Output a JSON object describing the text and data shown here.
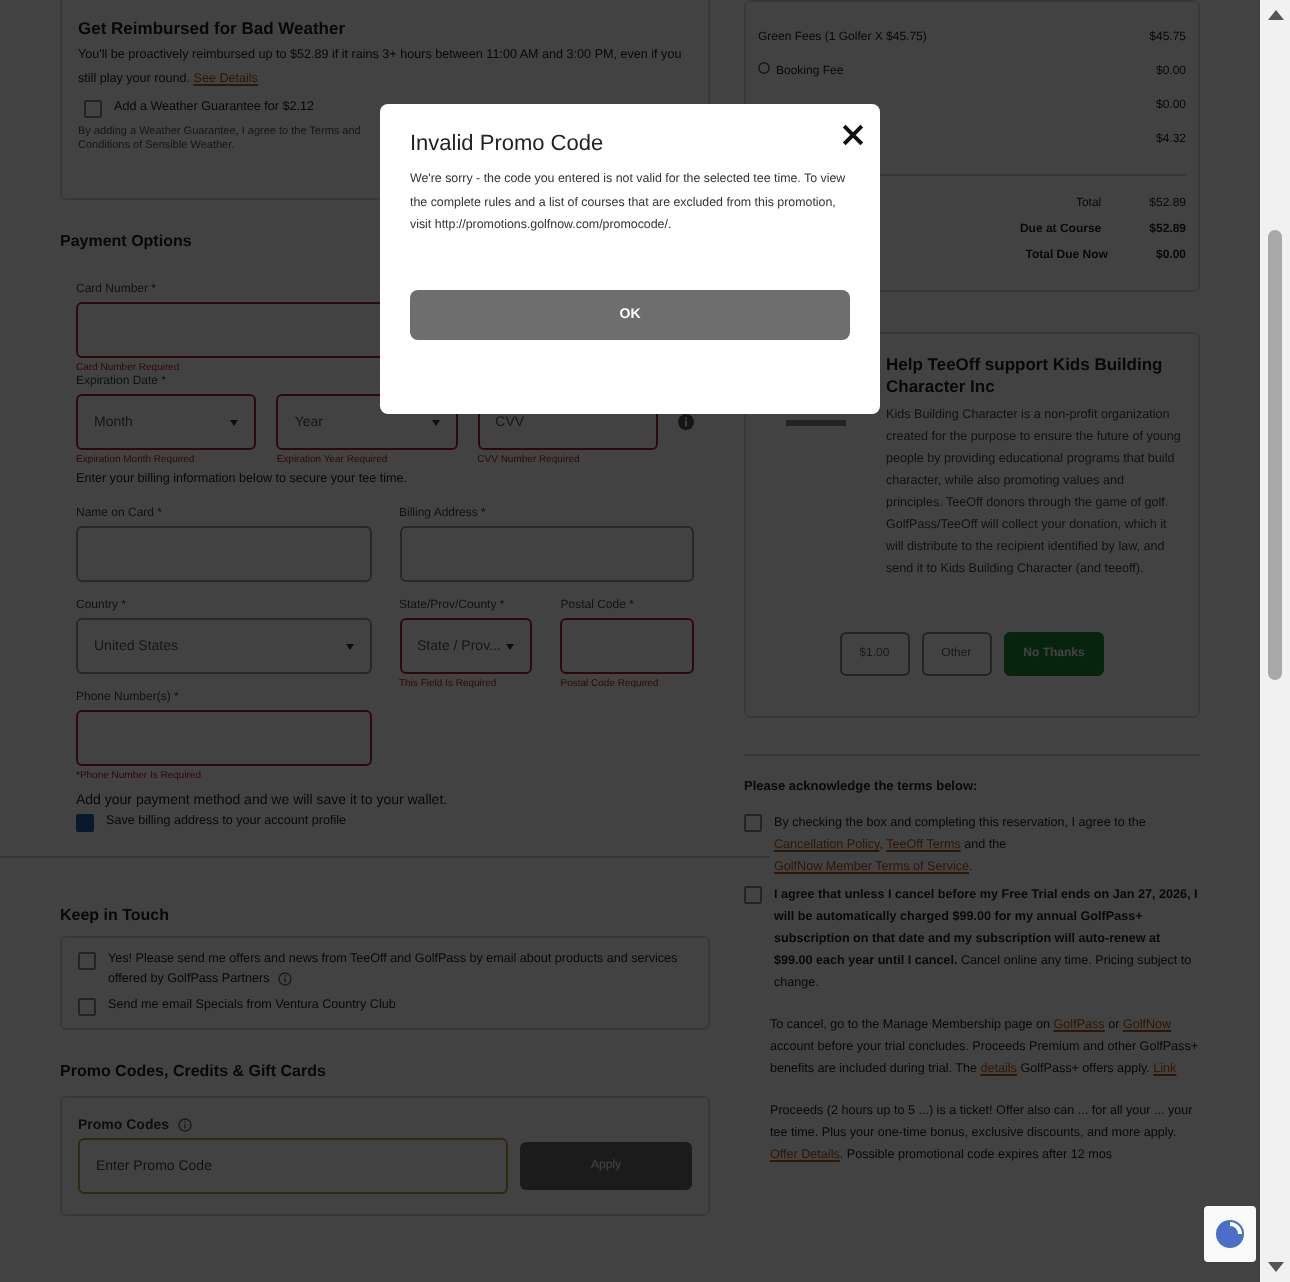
{
  "weather": {
    "title": "Get Reimbursed for Bad Weather",
    "text": "You'll be proactively reimbursed up to $52.89 if it rains 3+ hours between 11:00 AM and 3:00 PM, even if you still play your round.",
    "link": "See Details",
    "option": {
      "label": "Add a Weather Guarantee for $2.12",
      "checked": false
    },
    "fine_print": "By adding a Weather Guarantee, I agree to the Terms and Conditions of Sensible Weather."
  },
  "payment": {
    "title": "Payment Options",
    "card_number": {
      "label": "Card Number *",
      "invalid": true,
      "error": "Card Number Required"
    },
    "expiration": {
      "label": "Expiration Date *",
      "month": {
        "value": "Month",
        "invalid": true,
        "error": "Expiration Month Required"
      },
      "year": {
        "value": "Year",
        "invalid": true,
        "error": "Expiration Year Required"
      },
      "cvv": {
        "placeholder": "CVV",
        "invalid": true,
        "error": "CVV Number Required"
      }
    },
    "billing_note": "Enter your billing information below to secure your tee time.",
    "name_on_card": {
      "label": "Name on Card *",
      "invalid": false
    },
    "billing_address": {
      "label": "Billing Address *",
      "invalid": false
    },
    "country": {
      "label": "Country *",
      "value": "United States",
      "invalid": false
    },
    "state": {
      "label": "State/Prov/County *",
      "value": "State / Prov...",
      "invalid": true,
      "error": "This Field Is Required"
    },
    "postal": {
      "label": "Postal Code *",
      "invalid": true,
      "error": "Postal Code Required"
    },
    "phone": {
      "label": "Phone Number(s) *",
      "invalid": true,
      "error": "*Phone Number Is Required"
    },
    "wallet_note": "Add your payment method and we will save it to your wallet.",
    "save_billing": {
      "label": "Save billing address to your account profile",
      "checked": true
    }
  },
  "keep_in_touch": {
    "title": "Keep in Touch",
    "options": [
      {
        "label": "Yes! Please send me offers and news from TeeOff and GolfPass by email about products and services offered by GolfPass Partners",
        "checked": false,
        "info": true
      },
      {
        "label": "Send me email Specials from Ventura Country Club",
        "checked": false,
        "info": false
      }
    ]
  },
  "promo": {
    "title": "Promo Codes, Credits & Gift Cards",
    "label": "Promo Codes",
    "placeholder": "Enter Promo Code",
    "button": "Apply"
  },
  "summary": {
    "rows": [
      {
        "label": "Green Fees (1 Golfer X $45.75)",
        "value": "$45.75",
        "icon": false
      },
      {
        "label": "Booking Fee",
        "value": "$0.00",
        "icon": true
      },
      {
        "value": "$0.00"
      },
      {
        "value": "$4.32"
      }
    ],
    "totals": [
      {
        "label": "Total",
        "value": "$52.89",
        "bold": false
      },
      {
        "label": "Due at Course",
        "value": "$52.89",
        "bold": true
      },
      {
        "label": "Total Due Now",
        "value": "$0.00",
        "bold": true
      }
    ]
  },
  "donation": {
    "title": "Help TeeOff support Kids Building Character Inc",
    "description": "Kids Building Character is a non-profit organization created for the purpose to ensure the future of young people by providing educational programs that build character, while also promoting values and principles. TeeOff donors through the game of golf. GolfPass/TeeOff will collect your donation, which it will distribute to the recipient identified by law, and send it to Kids Building Character (and teeoff).",
    "buttons": [
      {
        "label": "$1.00",
        "kind": "amount"
      },
      {
        "label": "Other",
        "kind": "amount"
      },
      {
        "label": "No Thanks",
        "kind": "decline"
      }
    ]
  },
  "terms": {
    "title": "Please acknowledge the terms below:",
    "items": [
      {
        "checked": false,
        "segments": [
          {
            "text": "By checking the box and completing this reservation, I agree to the ",
            "kind": "text"
          },
          {
            "text": "Cancellation Policy",
            "kind": "link"
          },
          {
            "text": ", ",
            "kind": "text"
          },
          {
            "text": "TeeOff Terms",
            "kind": "link"
          },
          {
            "text": " and the ",
            "kind": "text"
          },
          {
            "text": "GolfNow Member Terms of Service",
            "kind": "link"
          },
          {
            "text": ".",
            "kind": "text"
          }
        ]
      },
      {
        "checked": false,
        "segments": [
          {
            "text": "**I agree that unless I cancel before my Free Trial ends on Jan 27, 2026, I will be automatically charged $99.00 for my annual GolfPass+ subscription on that date and my subscription will auto-renew at $99.00 each year until I cancel.** Cancel online any time. Pricing subject to change.",
            "kind": "text"
          }
        ]
      }
    ],
    "notes": [
      [
        {
          "text": "To cancel, go to the Manage Membership page on ",
          "kind": "text"
        },
        {
          "text": "GolfPass",
          "kind": "link"
        },
        {
          "text": " or ",
          "kind": "text"
        },
        {
          "text": "GolfNow",
          "kind": "link"
        },
        {
          "text": " account before your trial concludes. Proceeds Premium and other GolfPass+ benefits are included during trial. The ",
          "kind": "text"
        },
        {
          "text": "details",
          "kind": "link"
        },
        {
          "text": " GolfPass+ offers apply. ",
          "kind": "text"
        },
        {
          "text": "Link",
          "kind": "link"
        }
      ],
      [
        {
          "text": "Proceeds (2 hours up to 5 ...) is a ticket! Offer also can ... for all your ... your tee time. Plus your one-time bonus, exclusive discounts, and more apply. ",
          "kind": "text"
        },
        {
          "text": "Offer Details",
          "kind": "link"
        },
        {
          "text": ". Possible promotional code expires after 12 mos",
          "kind": "text"
        }
      ]
    ]
  },
  "modal": {
    "title": "Invalid Promo Code",
    "message": "We're sorry - the code you entered is not valid for the selected tee time. To view the complete rules and a list of courses that are excluded from this promotion, visit http://promotions.golfnow.com/promocode/.",
    "button": "OK"
  }
}
